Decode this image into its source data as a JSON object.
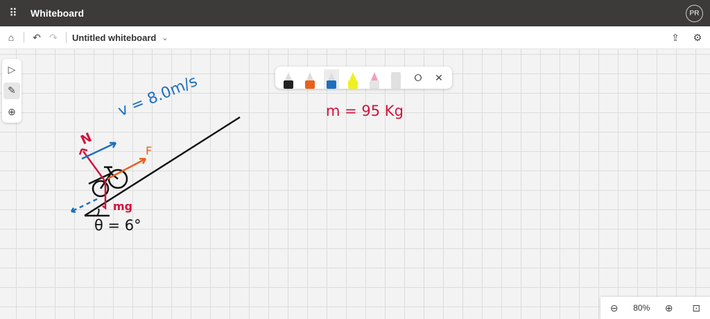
{
  "app": {
    "title": "Whiteboard",
    "avatar_initials": "PR"
  },
  "commandbar": {
    "board_title": "Untitled whiteboard"
  },
  "pens": [
    {
      "name": "black-pen",
      "color": "#222222"
    },
    {
      "name": "orange-pen",
      "color": "#e8601c"
    },
    {
      "name": "blue-pen",
      "color": "#1e6fc0"
    },
    {
      "name": "yellow-highlighter",
      "color": "#f0f020"
    },
    {
      "name": "eraser",
      "color": "#e8e8e8"
    },
    {
      "name": "ruler",
      "color": "#dddddd"
    }
  ],
  "annotations": {
    "velocity": "v = 8.0m/s",
    "normal": "N",
    "force": "F",
    "weight": "mg",
    "angle": "θ = 6°",
    "mass": "m = 95 Kg"
  },
  "colors": {
    "red": "#d0143c",
    "blue": "#1e6fc0",
    "orange": "#e8601c",
    "black": "#111111"
  },
  "zoom": {
    "level": "80%"
  }
}
